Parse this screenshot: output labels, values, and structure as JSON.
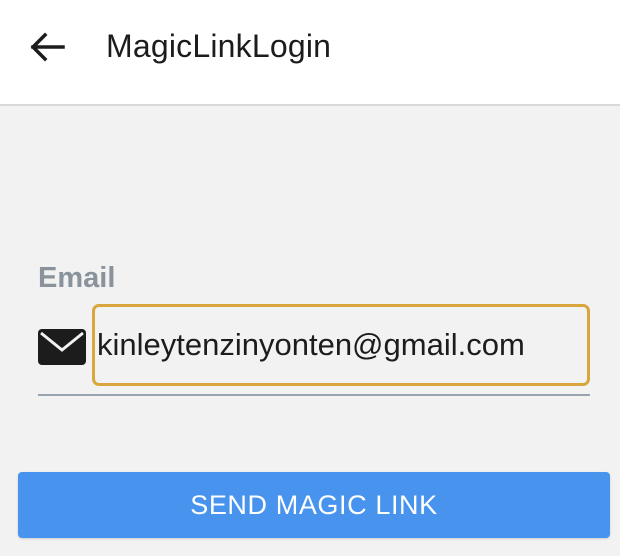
{
  "header": {
    "back_icon": "arrow-left-icon",
    "title": "MagicLinkLogin"
  },
  "form": {
    "email_label": "Email",
    "email_icon": "envelope-icon",
    "email_value": "kinleytenzinyonten@gmail.com",
    "submit_label": "SEND MAGIC LINK"
  },
  "colors": {
    "primary_button": "#4793ee",
    "input_focus_border": "#d9a53d",
    "label": "#8a939c",
    "background": "#f2f2f2"
  }
}
